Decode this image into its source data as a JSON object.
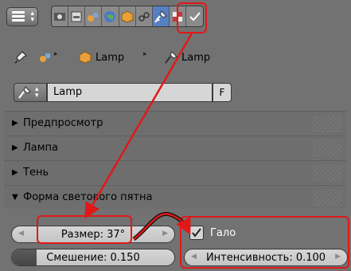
{
  "toolbar": {
    "editor_type": "properties-editor-icon",
    "context_buttons": [
      {
        "icon": "render-icon"
      },
      {
        "icon": "render-layers-icon"
      },
      {
        "icon": "scene-icon"
      },
      {
        "icon": "world-icon"
      },
      {
        "icon": "object-icon"
      },
      {
        "icon": "constraints-icon"
      },
      {
        "icon": "lamp-data-icon",
        "active": true
      },
      {
        "icon": "texture-icon"
      },
      {
        "icon": "particles-icon"
      }
    ]
  },
  "breadcrumb": {
    "object": "Lamp",
    "data": "Lamp"
  },
  "datablock": {
    "name": "Lamp",
    "fake_user": "F"
  },
  "panels": [
    {
      "label": "Предпросмотр",
      "expanded": false
    },
    {
      "label": "Лампа",
      "expanded": false
    },
    {
      "label": "Тень",
      "expanded": false
    },
    {
      "label": "Форма светового пятна",
      "expanded": true
    }
  ],
  "spot_shape": {
    "size_label": "Размер: 37°",
    "blend_label": "Смешение: 0.150",
    "blend_value": 0.15,
    "halo_label": "Гало",
    "halo_checked": true,
    "intensity_label": "Интенсивность: 0.100"
  },
  "colors": {
    "highlight": "#e01818",
    "active_tab": "#5680c2",
    "background": "#727272"
  }
}
